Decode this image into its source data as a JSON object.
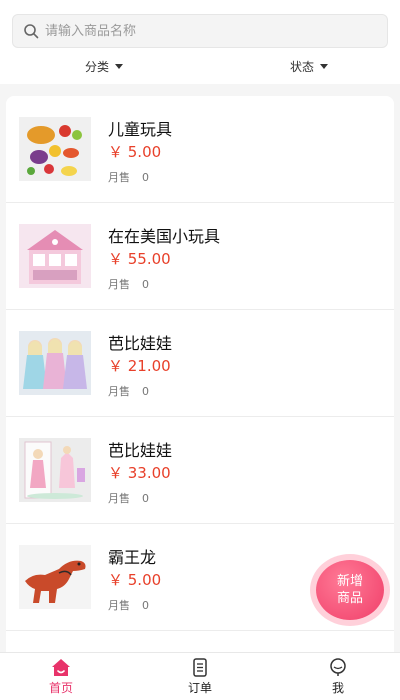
{
  "search": {
    "placeholder": "请输入商品名称",
    "icon": "search-icon"
  },
  "filters": [
    {
      "label": "分类"
    },
    {
      "label": "状态"
    }
  ],
  "products": [
    {
      "name": "儿童玩具",
      "price": "￥ 5.00",
      "sales_label": "月售",
      "sales_count": "0"
    },
    {
      "name": "在在美国小玩具",
      "price": "￥ 55.00",
      "sales_label": "月售",
      "sales_count": "0"
    },
    {
      "name": "芭比娃娃",
      "price": "￥ 21.00",
      "sales_label": "月售",
      "sales_count": "0"
    },
    {
      "name": "芭比娃娃",
      "price": "￥ 33.00",
      "sales_label": "月售",
      "sales_count": "0"
    },
    {
      "name": "霸王龙",
      "price": "￥ 5.00",
      "sales_label": "月售",
      "sales_count": "0"
    }
  ],
  "fab": {
    "line1": "新增",
    "line2": "商品"
  },
  "tabs": [
    {
      "label": "首页",
      "icon": "home-icon",
      "active": true
    },
    {
      "label": "订单",
      "icon": "order-icon",
      "active": false
    },
    {
      "label": "我",
      "icon": "profile-icon",
      "active": false
    }
  ],
  "colors": {
    "accent": "#e8336a",
    "price": "#e8402a",
    "fab": "#f03e69"
  }
}
